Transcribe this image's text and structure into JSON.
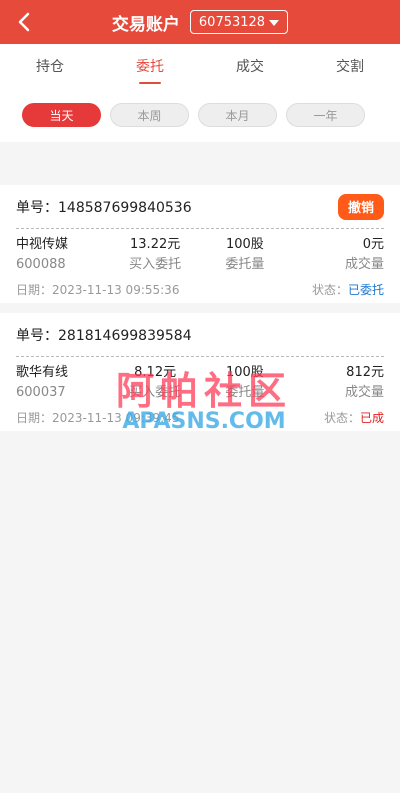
{
  "header": {
    "title": "交易账户",
    "account": "60753128"
  },
  "tabs": [
    {
      "label": "持仓"
    },
    {
      "label": "委托"
    },
    {
      "label": "成交"
    },
    {
      "label": "交割"
    }
  ],
  "filters": [
    {
      "label": "当天"
    },
    {
      "label": "本周"
    },
    {
      "label": "本月"
    },
    {
      "label": "一年"
    }
  ],
  "orders": [
    {
      "order_no": "单号：148587699840536",
      "cancel_label": "撤销",
      "name": "中视传媒",
      "code": "600088",
      "price": "13.22元",
      "price_label": "买入委托",
      "qty": "100股",
      "qty_label": "委托量",
      "deal": "0元",
      "deal_label": "成交量",
      "date": "日期：2023-11-13 09:55:36",
      "status_label": "状态：",
      "status": "已委托"
    },
    {
      "order_no": "单号：281814699839584",
      "name": "歌华有线",
      "code": "600037",
      "price": "8.12元",
      "price_label": "买入委托",
      "qty": "100股",
      "qty_label": "委托量",
      "deal": "812元",
      "deal_label": "成交量",
      "date": "日期：2023-11-13 09:39:45",
      "status_label": "状态：",
      "status": "已成"
    }
  ],
  "watermark": {
    "cn": "阿帕社区",
    "en": "APASNS.COM"
  },
  "colors": {
    "header": "#e64a3b",
    "cancel": "#ff5a17",
    "status_pending": "#1976d2",
    "status_done": "#e02020"
  }
}
